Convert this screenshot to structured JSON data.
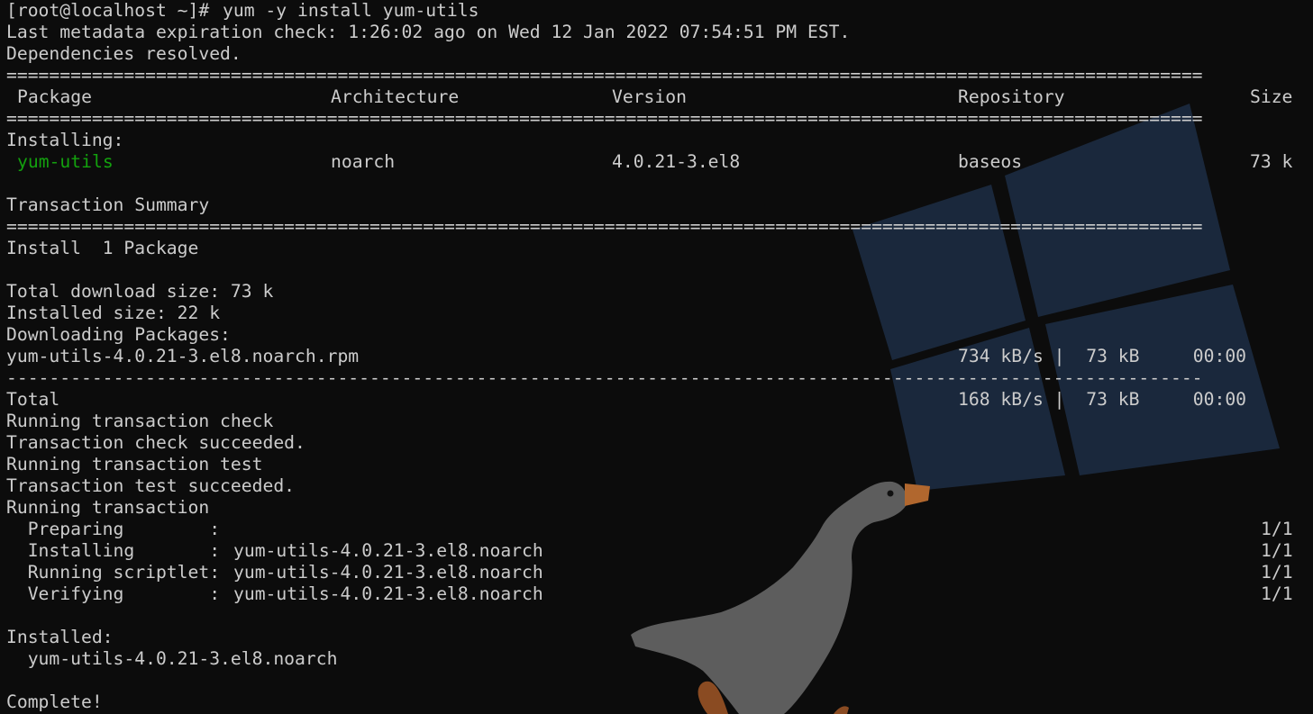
{
  "command": {
    "prompt": "[root@localhost ~]#",
    "text": "yum -y install yum-utils"
  },
  "meta": {
    "expiration": "Last metadata expiration check: 1:26:02 ago on Wed 12 Jan 2022 07:54:51 PM EST.",
    "deps": "Dependencies resolved."
  },
  "rule_eq": "================================================================================================================",
  "rule_dash": "----------------------------------------------------------------------------------------------------------------",
  "table": {
    "headers": {
      "package": "Package",
      "arch": "Architecture",
      "version": "Version",
      "repo": "Repository",
      "size": "Size"
    },
    "section": "Installing:",
    "rows": [
      {
        "package": "yum-utils",
        "arch": "noarch",
        "version": "4.0.21-3.el8",
        "repo": "baseos",
        "size": "73 k"
      }
    ]
  },
  "summary": {
    "title": "Transaction Summary",
    "install": "Install  1 Package",
    "total_download": "Total download size: 73 k",
    "installed_size": "Installed size: 22 k",
    "downloading": "Downloading Packages:"
  },
  "download": {
    "file": "yum-utils-4.0.21-3.el8.noarch.rpm",
    "file_stats": "734 kB/s |  73 kB     00:00",
    "total_label": "Total",
    "total_stats": "168 kB/s |  73 kB     00:00"
  },
  "transaction": {
    "check": "Running transaction check",
    "check_ok": "Transaction check succeeded.",
    "test": "Running transaction test",
    "test_ok": "Transaction test succeeded.",
    "running": "Running transaction",
    "steps": [
      {
        "label": "  Preparing        :",
        "pkg": "",
        "count": "1/1"
      },
      {
        "label": "  Installing       :",
        "pkg": "yum-utils-4.0.21-3.el8.noarch",
        "count": "1/1"
      },
      {
        "label": "  Running scriptlet:",
        "pkg": "yum-utils-4.0.21-3.el8.noarch",
        "count": "1/1"
      },
      {
        "label": "  Verifying        :",
        "pkg": "yum-utils-4.0.21-3.el8.noarch",
        "count": "1/1"
      }
    ]
  },
  "result": {
    "installed_label": "Installed:",
    "installed_pkg": "  yum-utils-4.0.21-3.el8.noarch",
    "complete": "Complete!"
  },
  "colors": {
    "background": "#0c0c0c",
    "text": "#cccccc",
    "package_green": "#13a10e",
    "window_logo": "#1b2a3f",
    "goose_body": "#5d5d5d",
    "goose_beak": "#b1672e"
  },
  "background_art": {
    "logo": "windows-logo-icon",
    "mascot": "goose-icon"
  }
}
